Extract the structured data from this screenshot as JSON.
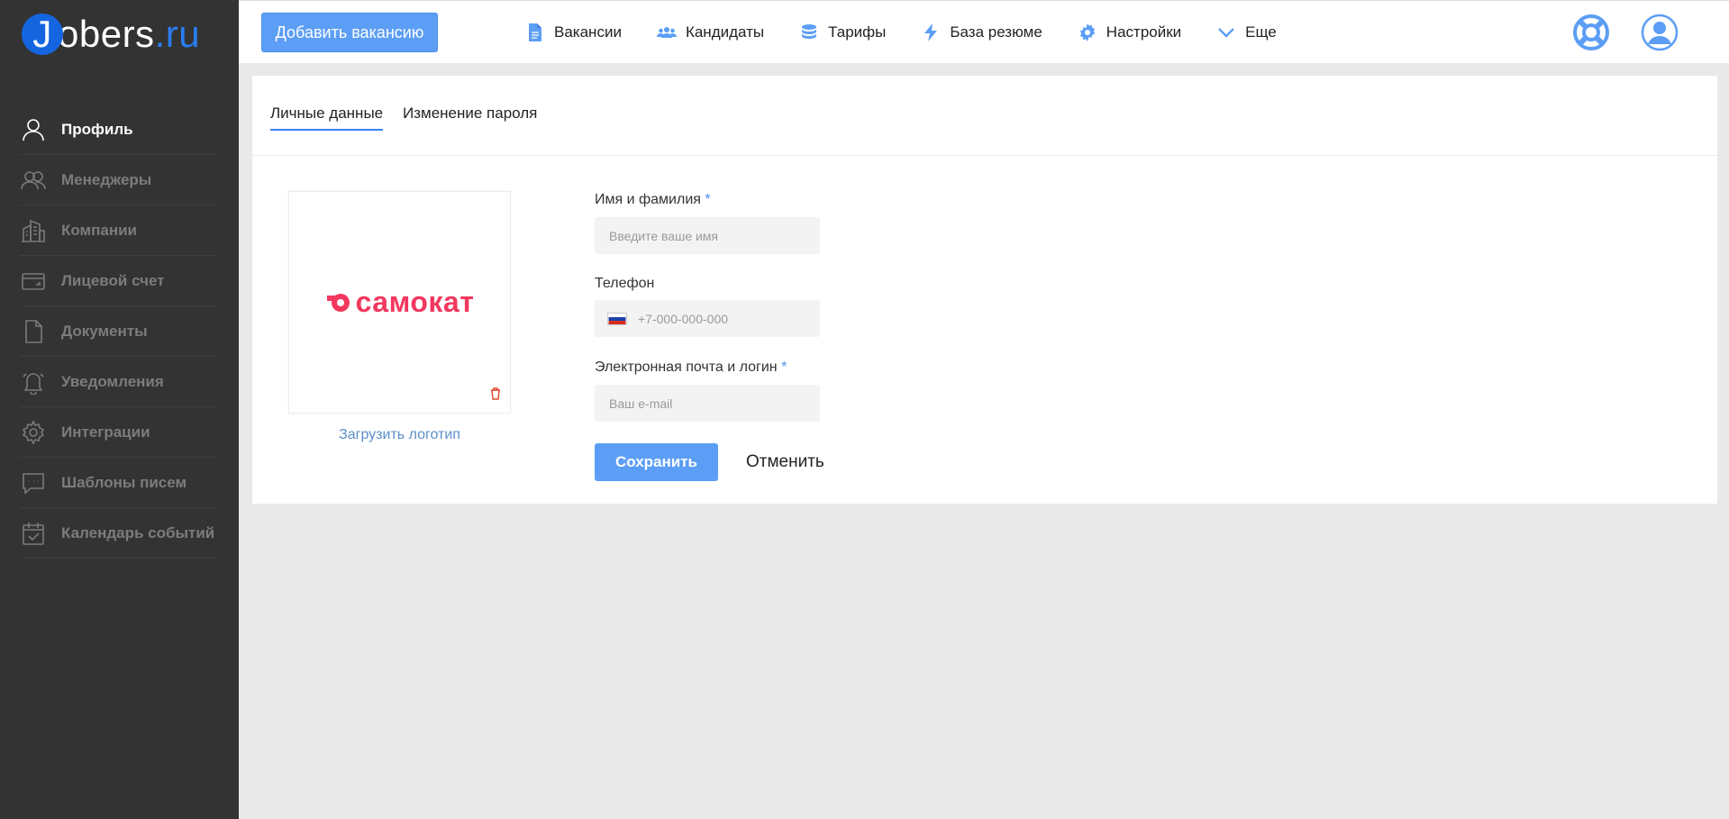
{
  "logo": {
    "letter": "J",
    "main": "obers",
    "tld": ".ru"
  },
  "sidebar": {
    "items": [
      {
        "label": "Профиль",
        "icon": "user-icon",
        "active": true
      },
      {
        "label": "Менеджеры",
        "icon": "users-icon"
      },
      {
        "label": "Компании",
        "icon": "building-icon"
      },
      {
        "label": "Лицевой счет",
        "icon": "card-icon"
      },
      {
        "label": "Документы",
        "icon": "document-icon"
      },
      {
        "label": "Уведомления",
        "icon": "bell-icon"
      },
      {
        "label": "Интеграции",
        "icon": "gear-icon"
      },
      {
        "label": "Шаблоны писем",
        "icon": "chat-icon"
      },
      {
        "label": "Календарь событий",
        "icon": "calendar-icon"
      }
    ]
  },
  "header": {
    "add_button": "Добавить вакансию",
    "nav": [
      {
        "label": "Вакансии",
        "icon": "document-icon"
      },
      {
        "label": "Кандидаты",
        "icon": "people-icon"
      },
      {
        "label": "Тарифы",
        "icon": "database-icon"
      },
      {
        "label": "База резюме",
        "icon": "lightning-icon"
      },
      {
        "label": "Настройки",
        "icon": "gear-icon"
      },
      {
        "label": "Еще",
        "icon": "chevron-down-icon"
      }
    ],
    "accent": "#4a8ee9"
  },
  "tabs": [
    {
      "label": "Личные данные",
      "active": true
    },
    {
      "label": "Изменение пароля"
    }
  ],
  "profile": {
    "company_logo_text": "самокат",
    "upload_link": "Загрузить логотип"
  },
  "form": {
    "name_label": "Имя и фамилия",
    "name_placeholder": "Введите ваше имя",
    "phone_label": "Телефон",
    "phone_placeholder": "+7-000-000-000",
    "email_label": "Электронная почта и логин",
    "email_placeholder": "Ваш e-mail",
    "required_mark": "*",
    "save": "Сохранить",
    "cancel": "Отменить"
  }
}
